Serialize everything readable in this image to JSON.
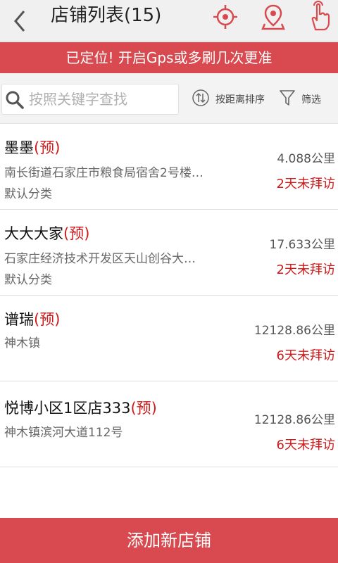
{
  "header": {
    "title": "店铺列表(15)",
    "icons": [
      "back-icon",
      "locate-target-icon",
      "map-pin-icon",
      "hand-pointer-icon"
    ],
    "accent_color": "#d84a4f"
  },
  "banner": {
    "text": "已定位! 开启Gps或多刷几次更准"
  },
  "filter": {
    "search_placeholder": "按照关键字查找",
    "sort_label": "按距离排序",
    "filter_label": "筛选"
  },
  "stores": [
    {
      "name": "墨墨",
      "tag": "(预)",
      "address": "南长街道石家庄市粮食局宿舍2号楼…",
      "category": "默认分类",
      "distance": "4.088公里",
      "visit": "2天未拜访"
    },
    {
      "name": "大大大家",
      "tag": "(预)",
      "address": "石家庄经济技术开发区天山创谷大…",
      "category": "默认分类",
      "distance": "17.633公里",
      "visit": "2天未拜访"
    },
    {
      "name": "谱瑞",
      "tag": "(预)",
      "address": "神木镇",
      "category": "",
      "distance": "12128.86公里",
      "visit": "6天未拜访"
    },
    {
      "name": "悦博小区1区店333",
      "tag": "(预)",
      "address": "神木镇滨河大道112号",
      "category": "",
      "distance": "12128.86公里",
      "visit": "6天未拜访"
    }
  ],
  "footer": {
    "add_label": "添加新店铺"
  }
}
